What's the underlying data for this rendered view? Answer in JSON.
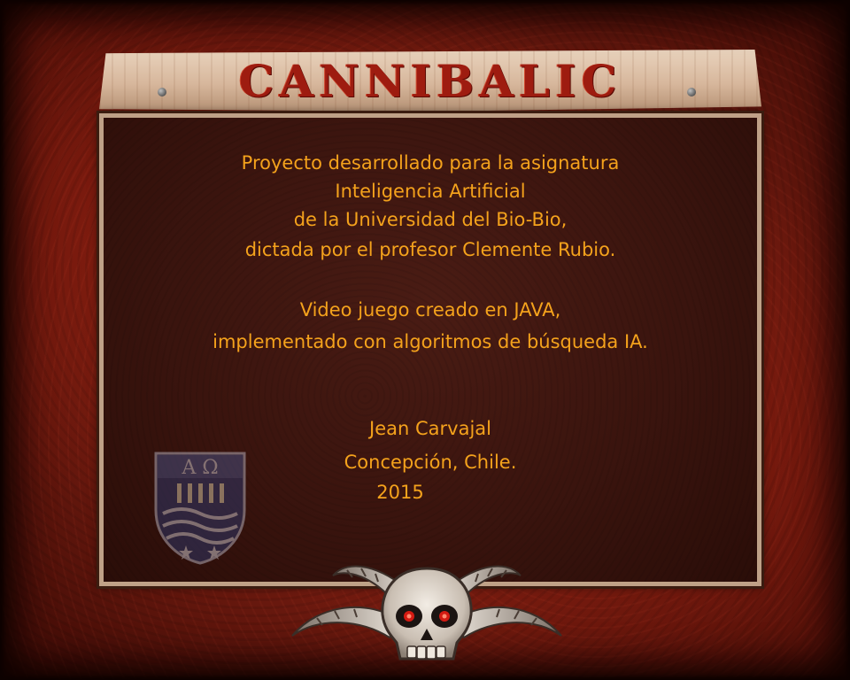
{
  "game": {
    "title": "CANNIBALIC"
  },
  "credits": {
    "lines": [
      "Proyecto desarrollado para la asignatura",
      "Inteligencia Artificial",
      "de la Universidad del Bio-Bio,",
      "dictada por el profesor Clemente Rubio.",
      "Video juego creado en JAVA,",
      "implementado con algoritmos de búsqueda IA.",
      "Jean Carvajal",
      "Concepción, Chile.",
      "2015"
    ]
  },
  "crest": {
    "letters": "Α Ω",
    "icon": "university-crest-icon"
  },
  "decoration": {
    "icon": "horned-skull-icon",
    "text_color": "#f4a21c",
    "title_color": "#9e1c10"
  }
}
